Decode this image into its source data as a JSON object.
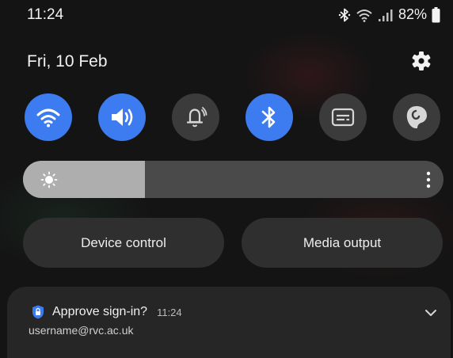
{
  "status_bar": {
    "time": "11:24",
    "battery": "82%",
    "icons": [
      "bluetooth-icon",
      "wifi-icon",
      "signal-icon",
      "battery-icon"
    ]
  },
  "header": {
    "date": "Fri, 10 Feb",
    "settings_icon": "gear-icon"
  },
  "quick_toggles": [
    {
      "name": "wifi",
      "icon": "wifi-icon",
      "active": true
    },
    {
      "name": "sound",
      "icon": "sound-icon",
      "active": true
    },
    {
      "name": "notification-bell",
      "icon": "bell-icon",
      "active": false
    },
    {
      "name": "bluetooth",
      "icon": "bluetooth-icon",
      "active": true
    },
    {
      "name": "caption",
      "icon": "caption-icon",
      "active": false
    },
    {
      "name": "profile",
      "icon": "profile-icon",
      "active": false
    }
  ],
  "brightness": {
    "level": 0.29
  },
  "buttons": {
    "device_control": "Device control",
    "media_output": "Media output"
  },
  "notification": {
    "title": "Approve sign-in?",
    "time": "11:24",
    "subtitle": "username@rvc.ac.uk"
  },
  "colors": {
    "accent": "#3d7cf0",
    "background": "#141414"
  }
}
